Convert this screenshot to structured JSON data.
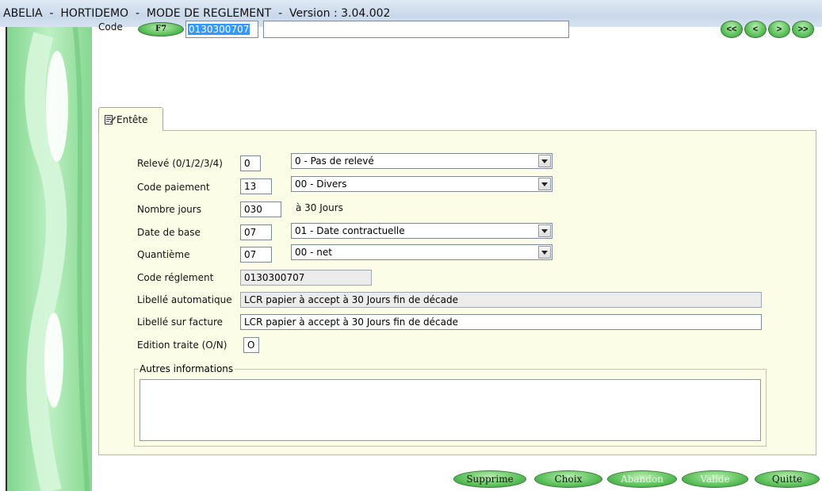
{
  "window": {
    "title": "ABELIA  -  HORTIDEMO  -  MODE DE REGLEMENT  -  Version : 3.04.002"
  },
  "header": {
    "code_label": "Code",
    "f7_label": "F7",
    "code_value": "0130300707",
    "code_desc_value": "",
    "nav": {
      "first": "<<",
      "prev": "<",
      "next": ">",
      "last": ">>"
    }
  },
  "tabs": [
    {
      "label": "Entête",
      "icon": "edit-document-icon",
      "active": true
    }
  ],
  "form": {
    "releve": {
      "label": "Relevé (0/1/2/3/4)",
      "value": "0",
      "combo": "0 - Pas de relevé"
    },
    "code_paiement": {
      "label": "Code paiement",
      "value": "13",
      "combo": "00 - Divers"
    },
    "nombre_jours": {
      "label": "Nombre jours",
      "value": "030",
      "suffix": "à 30 Jours"
    },
    "date_base": {
      "label": "Date de base",
      "value": "07",
      "combo": "01 - Date contractuelle"
    },
    "quantieme": {
      "label": "Quantième",
      "value": "07",
      "combo": "00 - net"
    },
    "code_reglement": {
      "label": "Code réglement",
      "value": "0130300707"
    },
    "libelle_auto": {
      "label": "Libellé automatique",
      "value": "LCR papier à accept à 30 Jours  fin de décade"
    },
    "libelle_facture": {
      "label": "Libellé sur facture",
      "value": "LCR papier à accept à 30 Jours  fin de décade"
    },
    "edition_traite": {
      "label": "Edition traite (O/N)",
      "value": "O"
    },
    "autres": {
      "label": "Autres informations",
      "value": ""
    }
  },
  "footer": {
    "supprime": "Supprime",
    "choix": "Choix",
    "abandon": "Abandon",
    "valide": "Valide",
    "quitte": "Quitte"
  },
  "colors": {
    "panel_bg": "#fcfde6",
    "button_green": "#5cc05a",
    "stripe_green": "#9fe0a8",
    "selection_blue": "#3399ff"
  }
}
